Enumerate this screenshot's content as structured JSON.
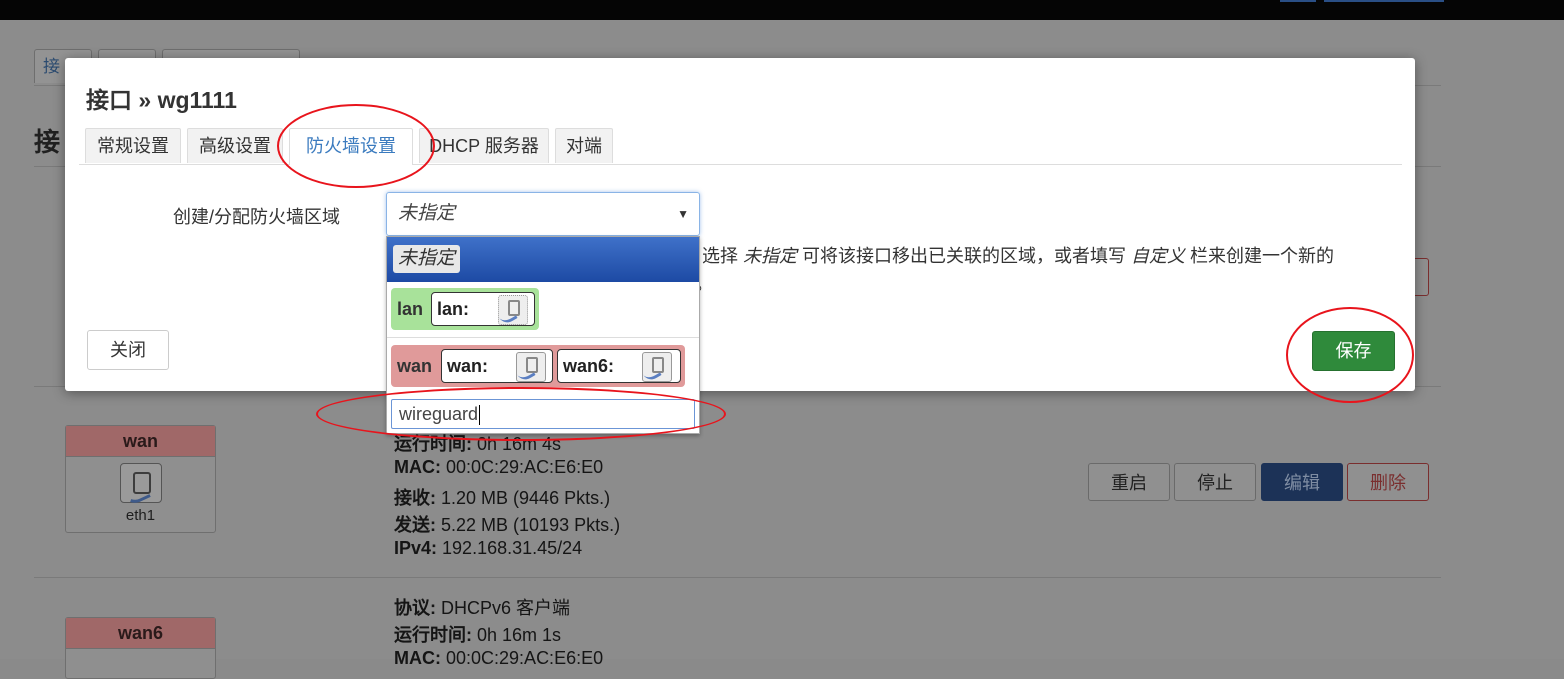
{
  "background": {
    "tabs": [
      "接",
      "",
      ""
    ],
    "heading": "接",
    "wan_card": {
      "zone": "wan",
      "device": "eth1"
    },
    "wan6_card": {
      "zone": "wan6"
    },
    "wan_info": [
      {
        "label": "运行时间:",
        "value": " 0h 16m 4s"
      },
      {
        "label": "MAC:",
        "value": " 00:0C:29:AC:E6:E0"
      },
      {
        "label": "接收:",
        "value": " 1.20 MB (9446 Pkts.)"
      },
      {
        "label": "发送:",
        "value": " 5.22 MB (10193 Pkts.)"
      },
      {
        "label": "IPv4:",
        "value": " 192.168.31.45/24"
      }
    ],
    "wan6_info": [
      {
        "label": "协议:",
        "value": " DHCPv6 客户端"
      },
      {
        "label": "运行时间:",
        "value": " 0h 16m 1s"
      },
      {
        "label": "MAC:",
        "value": " 00:0C:29:AC:E6:E0"
      }
    ],
    "row_buttons": {
      "restart": "重启",
      "stop": "停止",
      "edit": "编辑",
      "delete": "删除"
    }
  },
  "modal": {
    "title": "接口 » wg1111",
    "tabs": [
      "常规设置",
      "高级设置",
      "防火墙设置",
      "DHCP 服务器",
      "对端"
    ],
    "active_tab": "防火墙设置",
    "field_label": "创建/分配防火墙区域",
    "select_value": "未指定",
    "description": {
      "prefix": "选择 ",
      "em1": "未指定",
      "middle": " 可将该接口移出已关联的区域，或者填写 ",
      "em2": "自定义",
      "suffix": " 栏来创建一个新的",
      "line2": "。"
    },
    "close_label": "关闭",
    "save_label": "保存"
  },
  "dropdown": {
    "selected_option": "未指定",
    "lan_zone": {
      "name": "lan",
      "networks": [
        "lan:"
      ],
      "color": "#a8e29a"
    },
    "wan_zone": {
      "name": "wan",
      "networks": [
        "wan:",
        "wan6:"
      ],
      "color": "#e09a9a"
    },
    "custom_input_value": "wireguard"
  },
  "annotation_color": "#e8141c",
  "colors": {
    "accent_blue": "#3b7bbf",
    "save_green": "#2f8a3b"
  }
}
